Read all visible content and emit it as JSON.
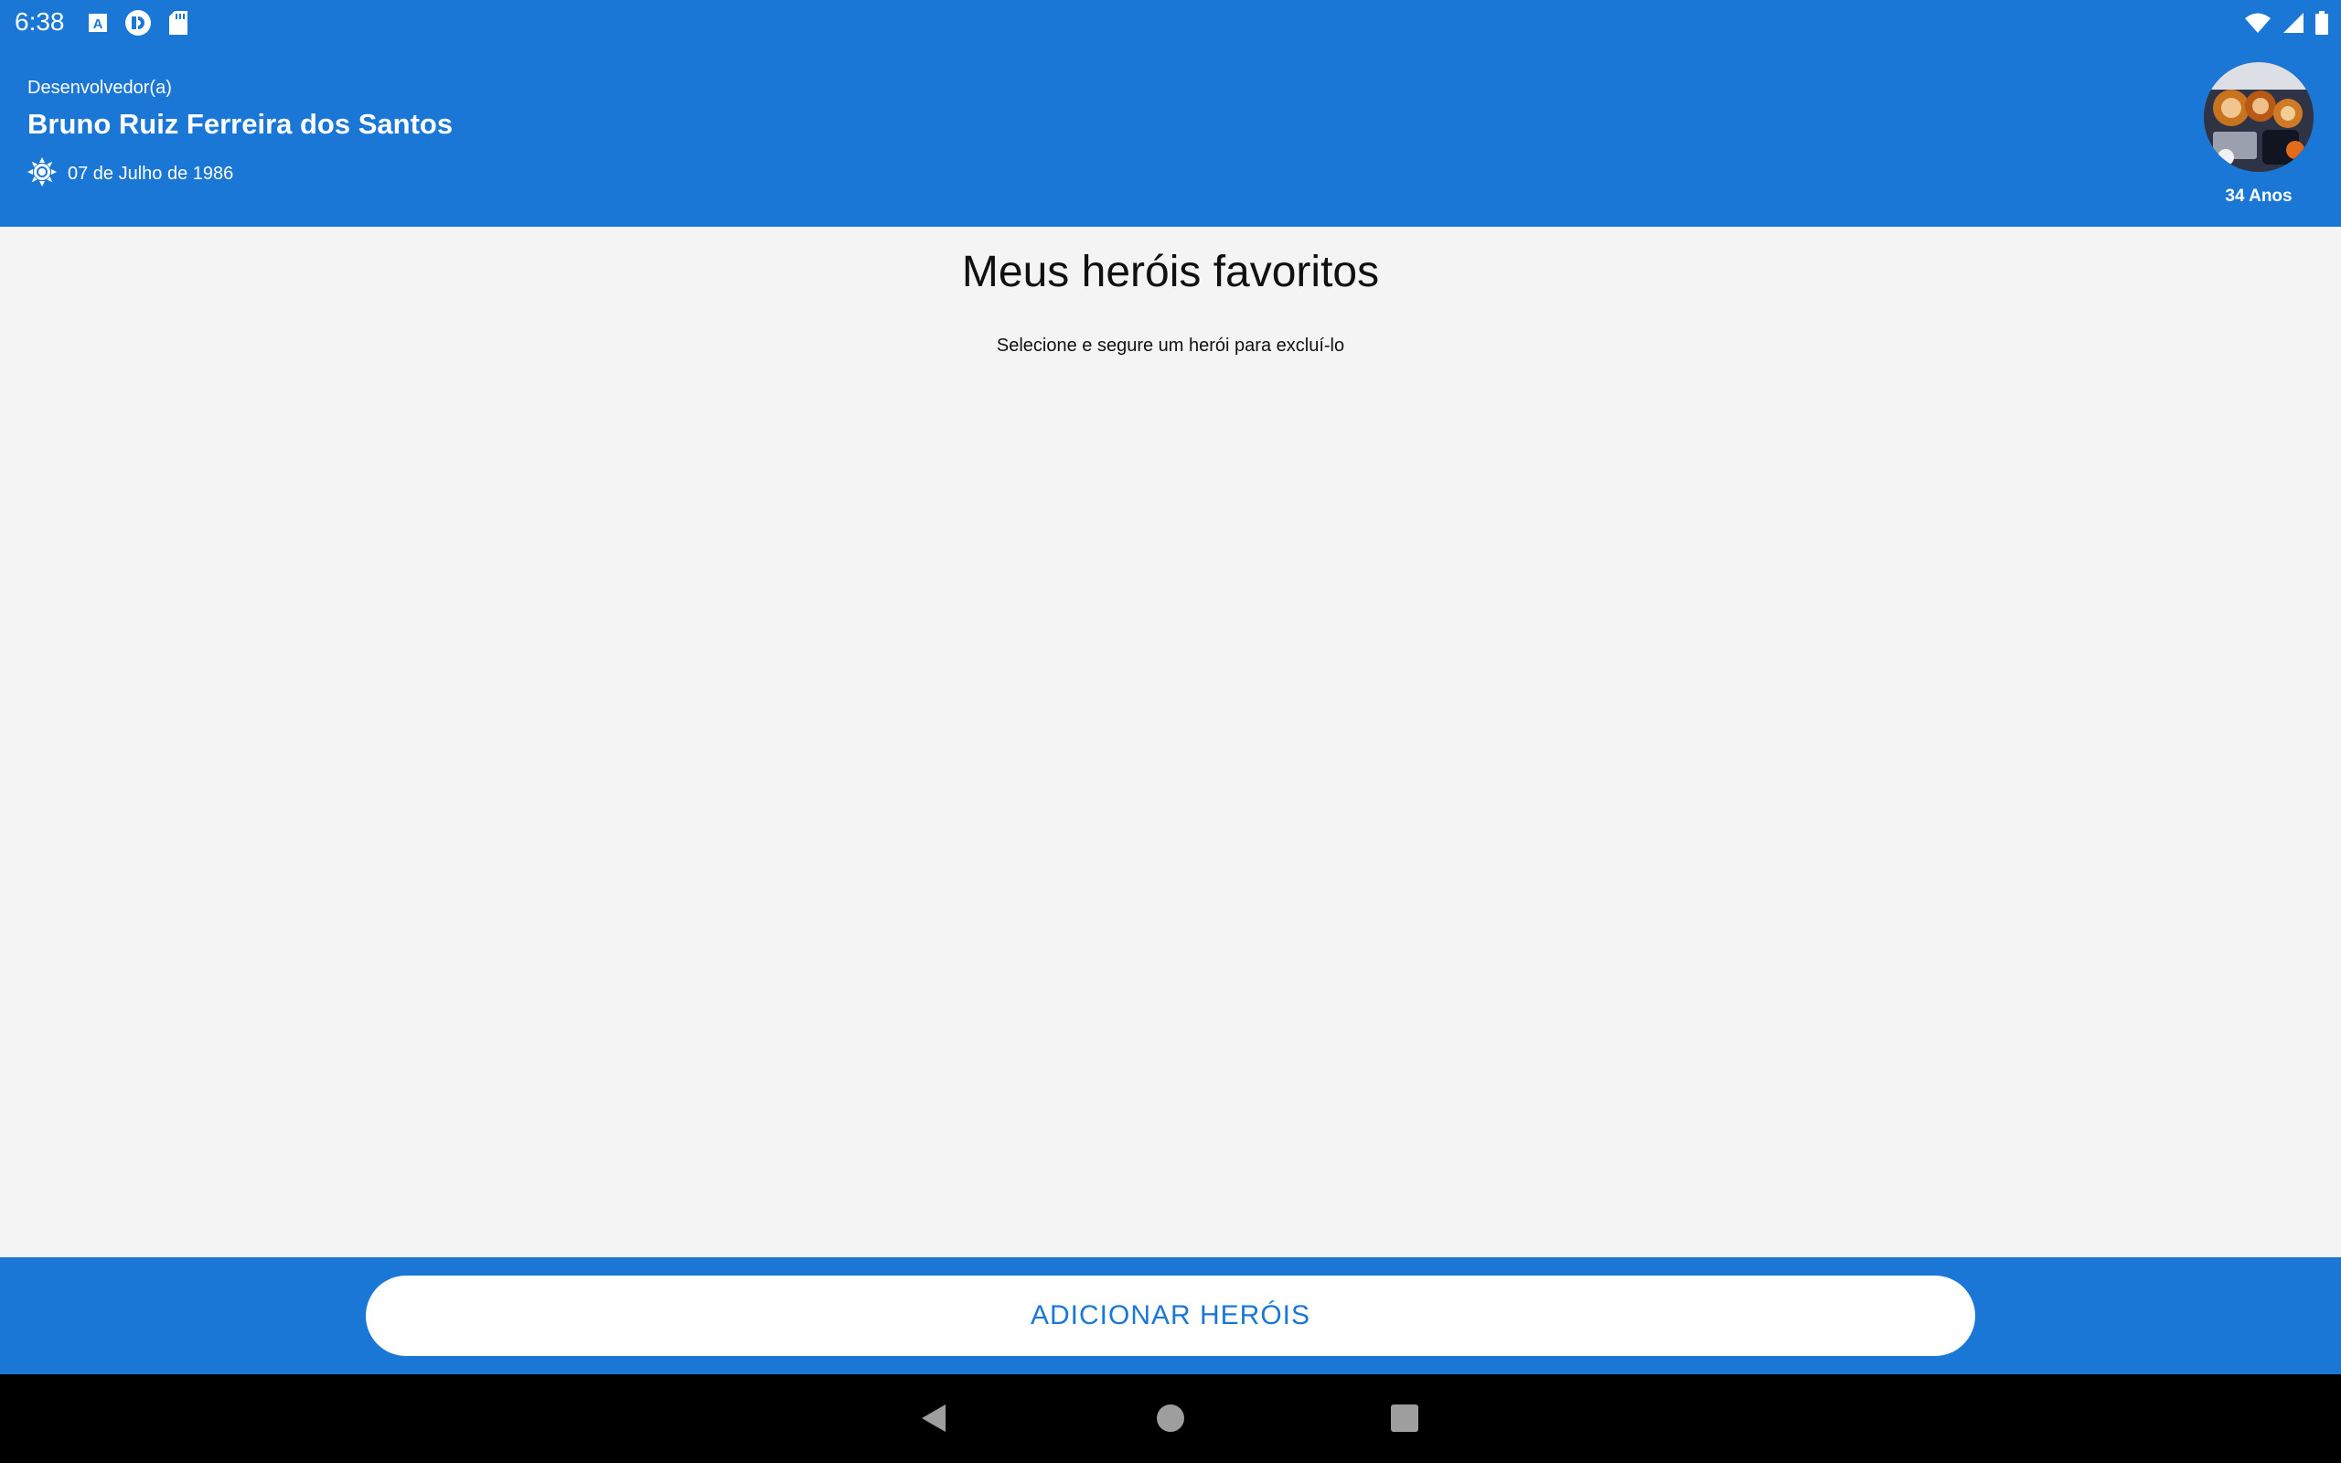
{
  "status_bar": {
    "time": "6:38",
    "left_icons": [
      "a-notification-icon",
      "pocket-casts-icon",
      "sd-card-icon"
    ],
    "right_icons": [
      "wifi-icon",
      "cellular-signal-icon",
      "battery-icon"
    ]
  },
  "header": {
    "role": "Desenvolvedor(a)",
    "name": "Bruno Ruiz Ferreira dos Santos",
    "birth_icon": "sun-icon",
    "birth_date": "07 de Julho de 1986",
    "age": "34 Anos"
  },
  "main": {
    "title": "Meus heróis favoritos",
    "subtitle": "Selecione e segure um herói para excluí-lo"
  },
  "actions": {
    "add_button_label": "ADICIONAR HERÓIS"
  },
  "nav": {
    "back": "back-icon",
    "home": "home-icon",
    "recents": "recents-icon"
  },
  "colors": {
    "primary": "#1b77d6",
    "background": "#f4f4f4",
    "nav_bar": "#000000"
  }
}
